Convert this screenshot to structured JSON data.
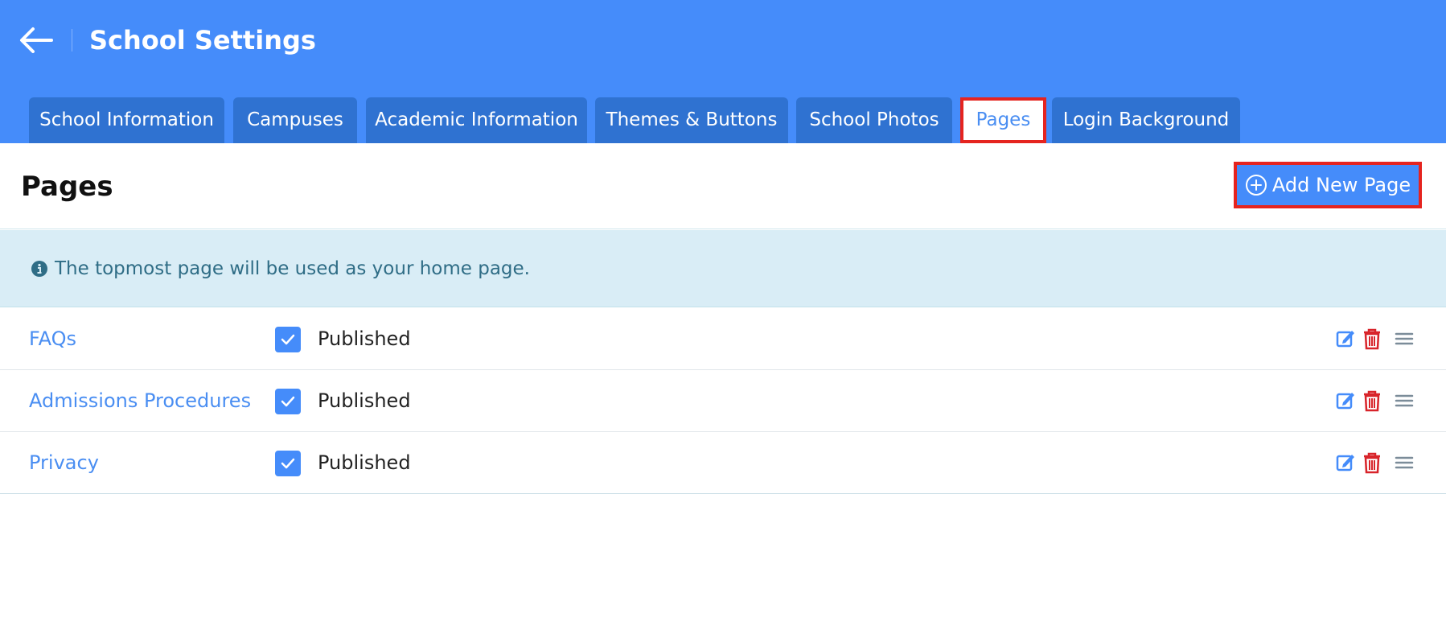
{
  "header": {
    "title": "School Settings",
    "back_icon": "arrow-left-icon"
  },
  "tabs": [
    {
      "label": "School Information",
      "active": false
    },
    {
      "label": "Campuses",
      "active": false
    },
    {
      "label": "Academic Information",
      "active": false
    },
    {
      "label": "Themes & Buttons",
      "active": false
    },
    {
      "label": "School Photos",
      "active": false
    },
    {
      "label": "Pages",
      "active": true
    },
    {
      "label": "Login Background",
      "active": false
    }
  ],
  "section": {
    "title": "Pages",
    "add_button_label": "Add New Page",
    "add_icon": "plus-circle-icon"
  },
  "info": {
    "text": "The topmost page will be used as your home page.",
    "icon": "info-circle-icon"
  },
  "pages": [
    {
      "name": "FAQs",
      "status": "Published",
      "checked": true
    },
    {
      "name": "Admissions Procedures",
      "status": "Published",
      "checked": true
    },
    {
      "name": "Privacy",
      "status": "Published",
      "checked": true
    }
  ],
  "colors": {
    "header_bg": "#458cfa",
    "tab_bg": "#2f72d1",
    "highlight": "#e5241f",
    "link": "#4a8ef2",
    "delete": "#d8242a",
    "info_bg": "#d9edf6"
  }
}
